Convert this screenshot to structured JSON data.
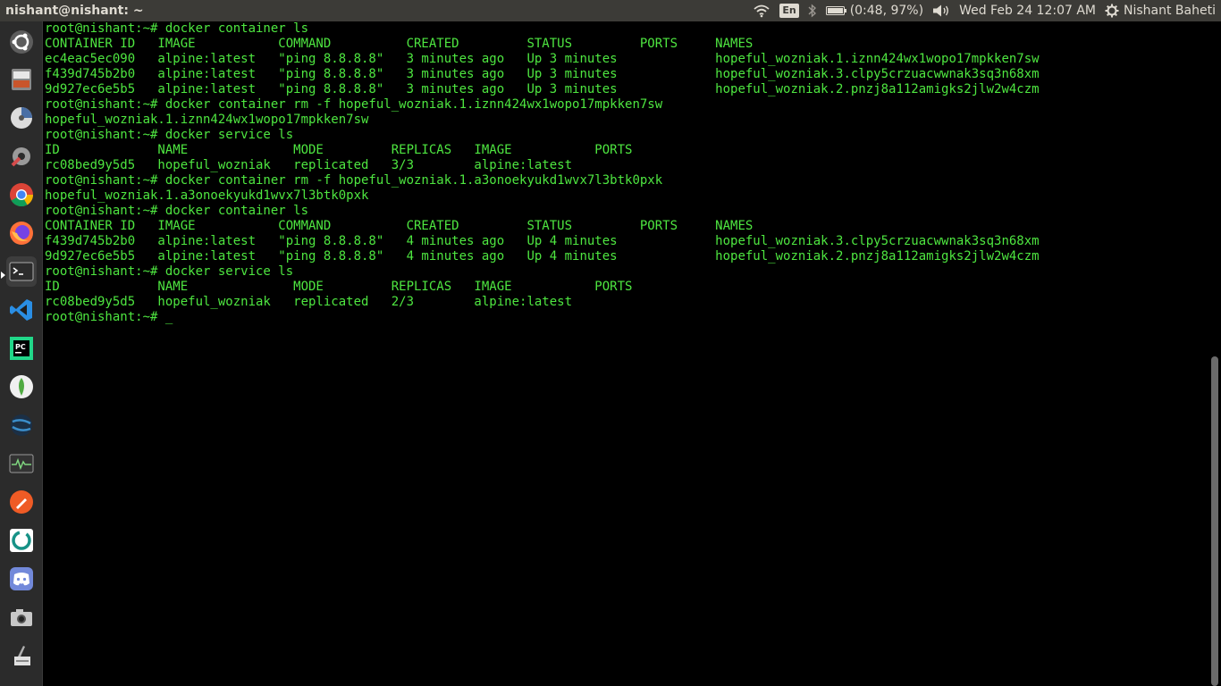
{
  "top_panel": {
    "window_title": "nishant@nishant: ~",
    "keyboard_layout": "En",
    "battery": "(0:48, 97%)",
    "datetime": "Wed Feb 24 12:07 AM",
    "user_name": "Nishant Baheti",
    "icons": [
      "wifi-icon",
      "keyboard-icon",
      "bluetooth-icon",
      "battery-icon",
      "volume-icon",
      "settings-gear-icon"
    ]
  },
  "launcher": {
    "items": [
      {
        "name": "ubuntu-dash",
        "color": "#e95420"
      },
      {
        "name": "file-cabinet",
        "color": "#c9552b"
      },
      {
        "name": "disk-space",
        "color": "#4a6fa5"
      },
      {
        "name": "system-settings",
        "color": "#d64b4b"
      },
      {
        "name": "chrome",
        "color": "#4285f4"
      },
      {
        "name": "firefox",
        "color": "#ff7139"
      },
      {
        "name": "terminal",
        "color": "#2c2c2c"
      },
      {
        "name": "vscode",
        "color": "#2a8ee4"
      },
      {
        "name": "pycharm",
        "color": "#21d789"
      },
      {
        "name": "mongodb",
        "color": "#4faa41"
      },
      {
        "name": "satellite",
        "color": "#3b8ecb"
      },
      {
        "name": "system-monitor",
        "color": "#333333"
      },
      {
        "name": "postman",
        "color": "#ef5b25"
      },
      {
        "name": "gitkraken",
        "color": "#179287"
      },
      {
        "name": "discord",
        "color": "#7289da"
      },
      {
        "name": "camera",
        "color": "#9a9a9a"
      },
      {
        "name": "usb-creator",
        "color": "#e0e0e0"
      }
    ]
  },
  "terminal": {
    "text_color": "#4ee640",
    "lines": [
      "root@nishant:~# docker container ls",
      "CONTAINER ID   IMAGE           COMMAND          CREATED         STATUS         PORTS     NAMES",
      "ec4eac5ec090   alpine:latest   \"ping 8.8.8.8\"   3 minutes ago   Up 3 minutes             hopeful_wozniak.1.iznn424wx1wopo17mpkken7sw",
      "f439d745b2b0   alpine:latest   \"ping 8.8.8.8\"   3 minutes ago   Up 3 minutes             hopeful_wozniak.3.clpy5crzuacwwnak3sq3n68xm",
      "9d927ec6e5b5   alpine:latest   \"ping 8.8.8.8\"   3 minutes ago   Up 3 minutes             hopeful_wozniak.2.pnzj8a112amigks2jlw2w4czm",
      "root@nishant:~# docker container rm -f hopeful_wozniak.1.iznn424wx1wopo17mpkken7sw",
      "hopeful_wozniak.1.iznn424wx1wopo17mpkken7sw",
      "root@nishant:~# docker service ls",
      "ID             NAME              MODE         REPLICAS   IMAGE           PORTS",
      "rc08bed9y5d5   hopeful_wozniak   replicated   3/3        alpine:latest",
      "root@nishant:~# docker container rm -f hopeful_wozniak.1.a3onoekyukd1wvx7l3btk0pxk",
      "hopeful_wozniak.1.a3onoekyukd1wvx7l3btk0pxk",
      "root@nishant:~# docker container ls",
      "CONTAINER ID   IMAGE           COMMAND          CREATED         STATUS         PORTS     NAMES",
      "f439d745b2b0   alpine:latest   \"ping 8.8.8.8\"   4 minutes ago   Up 4 minutes             hopeful_wozniak.3.clpy5crzuacwwnak3sq3n68xm",
      "9d927ec6e5b5   alpine:latest   \"ping 8.8.8.8\"   4 minutes ago   Up 4 minutes             hopeful_wozniak.2.pnzj8a112amigks2jlw2w4czm",
      "root@nishant:~# docker service ls",
      "ID             NAME              MODE         REPLICAS   IMAGE           PORTS",
      "rc08bed9y5d5   hopeful_wozniak   replicated   2/3        alpine:latest"
    ],
    "prompt": "root@nishant:~# ",
    "cursor": "_"
  }
}
